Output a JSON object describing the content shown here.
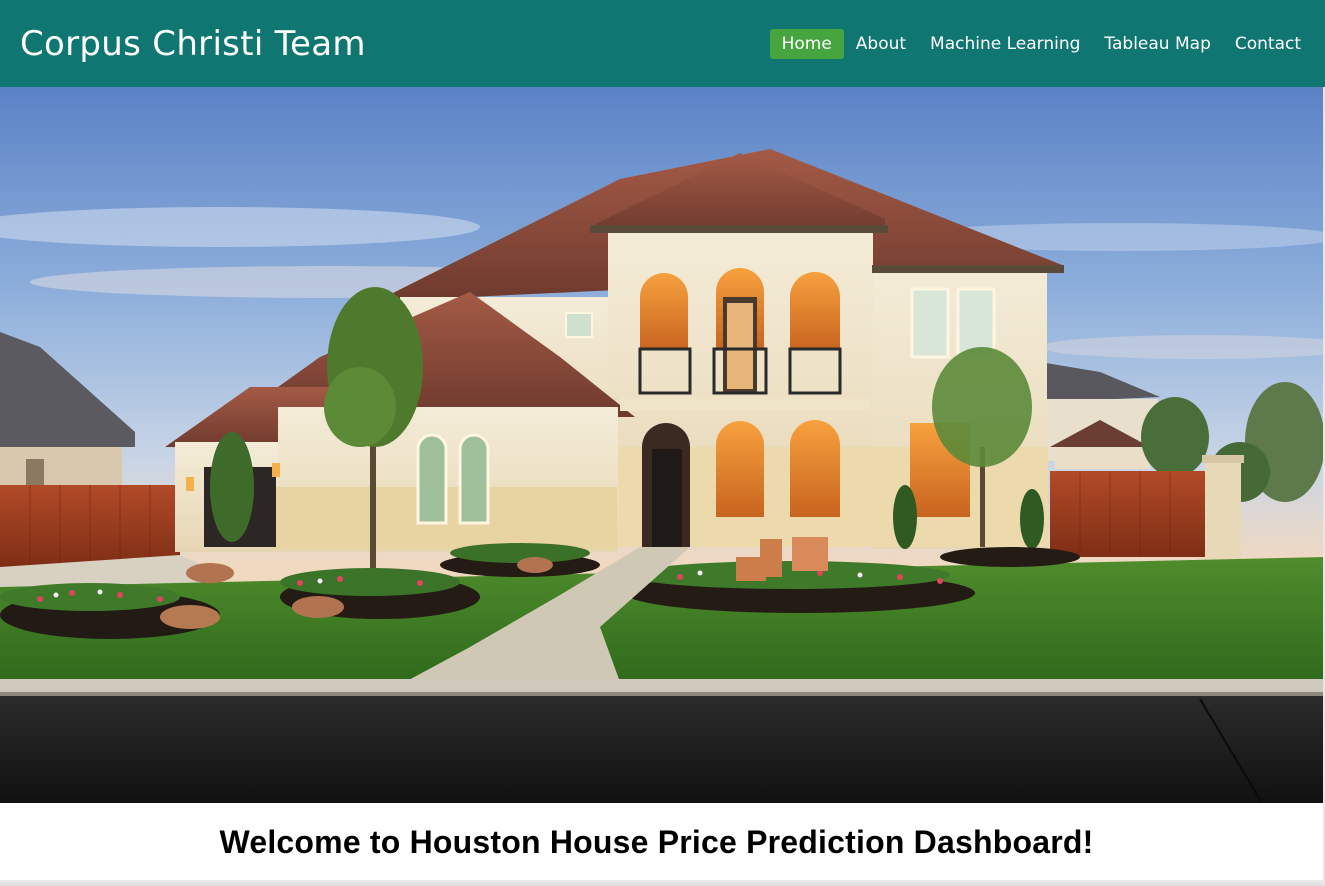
{
  "navbar": {
    "brand": "Corpus Christi Team",
    "links": [
      {
        "label": "Home",
        "active": true
      },
      {
        "label": "About",
        "active": false
      },
      {
        "label": "Machine Learning",
        "active": false
      },
      {
        "label": "Tableau Map",
        "active": false
      },
      {
        "label": "Contact",
        "active": false
      }
    ]
  },
  "hero": {
    "image_subject": "house-photo"
  },
  "welcome": {
    "heading": "Welcome to Houston House Price Prediction Dashboard!"
  },
  "colors": {
    "navbar_bg": "#0f7672",
    "active_link_bg": "#46a53f",
    "nav_text": "#ffffff"
  }
}
